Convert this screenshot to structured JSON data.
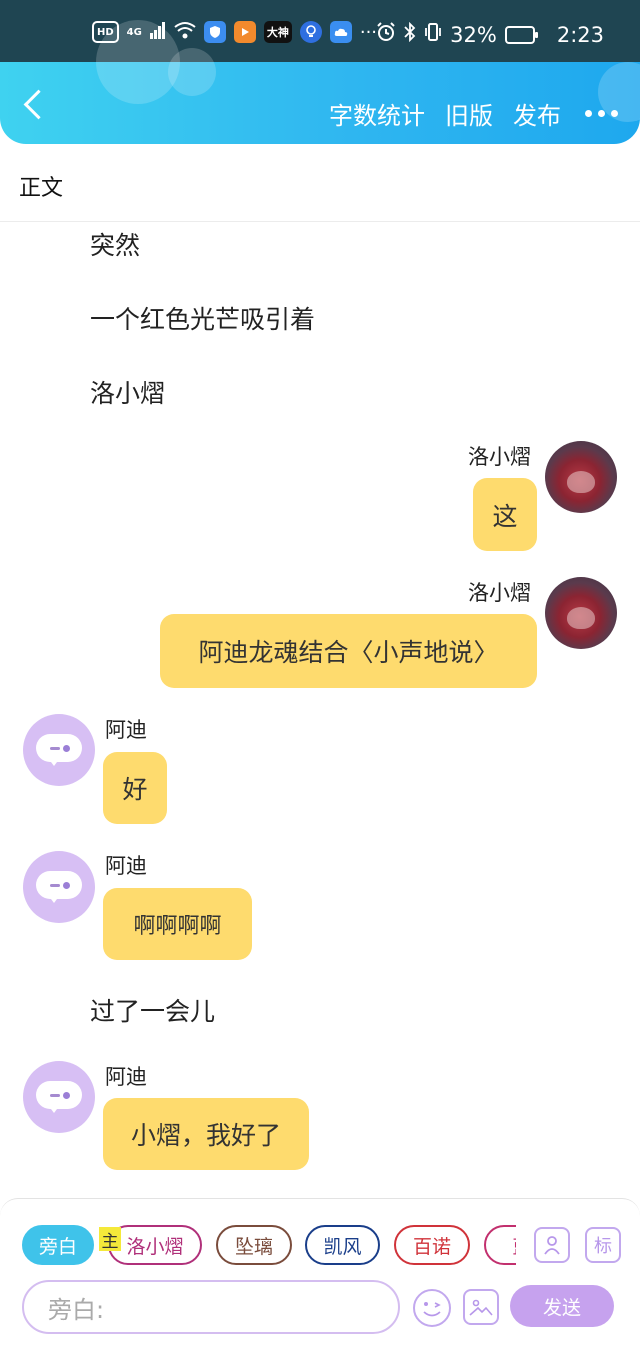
{
  "status_bar": {
    "left_badges": [
      "HD",
      "4G"
    ],
    "app_badge": "大神",
    "more": "···",
    "battery": "32%",
    "time": "2:23"
  },
  "header": {
    "actions": [
      "字数统计",
      "旧版",
      "发布"
    ]
  },
  "section_title": "正文",
  "narrations": [
    "突然",
    "一个红色光芒吸引着",
    "洛小熠",
    "过了一会儿"
  ],
  "messages": [
    {
      "side": "right",
      "name": "洛小熠",
      "text": "这"
    },
    {
      "side": "right",
      "name": "洛小熠",
      "text": "阿迪龙魂结合〈小声地说〉"
    },
    {
      "side": "left",
      "name": "阿迪",
      "text": "好"
    },
    {
      "side": "left",
      "name": "阿迪",
      "text": "啊啊啊啊"
    },
    {
      "side": "left",
      "name": "阿迪",
      "text": "小熠，我好了"
    }
  ],
  "composer": {
    "host_tag": "主",
    "chips": [
      {
        "label": "旁白",
        "color": "#3fc3ea"
      },
      {
        "label": "洛小熠",
        "color": "#b0307a"
      },
      {
        "label": "坠璃",
        "color": "#7a4c3c"
      },
      {
        "label": "凯风",
        "color": "#1a3e8a"
      },
      {
        "label": "百诺",
        "color": "#d0333a"
      },
      {
        "label": "蓝",
        "color": "#c2306e"
      }
    ],
    "role_icon": "person-card-icon",
    "tag_label": "标",
    "input_placeholder": "旁白:",
    "send_label": "发送"
  },
  "colors": {
    "header_start": "#3fd2f0",
    "header_end": "#1ea8ee",
    "bubble": "#fedb6e",
    "accent_purple": "#c6a2ee"
  }
}
